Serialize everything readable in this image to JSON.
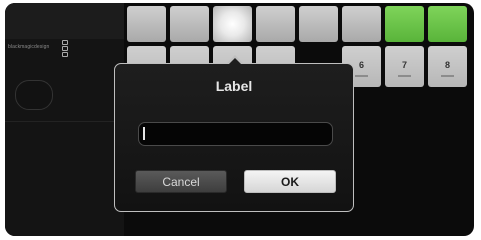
{
  "background_panel": {
    "brand_text": "blackmagicdesign",
    "key_numbers": [
      "",
      "",
      "",
      "",
      "6",
      "7",
      "8"
    ]
  },
  "dialog": {
    "title": "Label",
    "input_value": "",
    "cancel_label": "Cancel",
    "ok_label": "OK"
  },
  "colors": {
    "dialog_bg": "#1a1a1a",
    "key_white": "#c8c8c8",
    "key_green": "#6cc64a",
    "ok_button": "#e8e8e8",
    "cancel_button": "#4b4b4b"
  }
}
